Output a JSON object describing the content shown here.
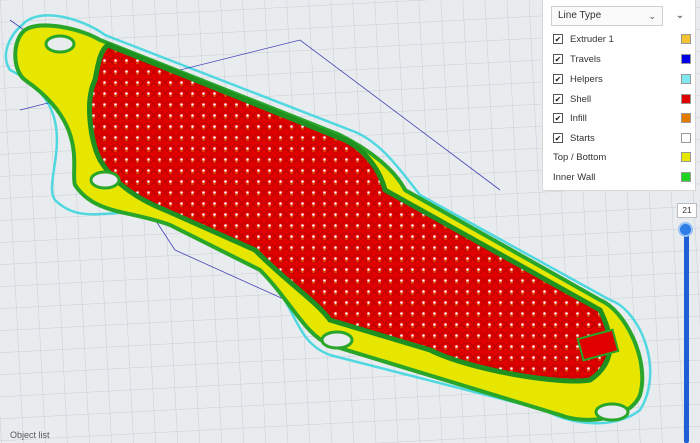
{
  "legend": {
    "dropdown": {
      "selected": "Line Type"
    },
    "items": [
      {
        "label": "Extruder 1",
        "checked": true,
        "color": "#f2c230"
      },
      {
        "label": "Travels",
        "checked": true,
        "color": "#0000e6"
      },
      {
        "label": "Helpers",
        "checked": true,
        "color": "#7fe8ee"
      },
      {
        "label": "Shell",
        "checked": true,
        "color": "#e00000"
      },
      {
        "label": "Infill",
        "checked": true,
        "color": "#e67a00"
      },
      {
        "label": "Starts",
        "checked": true,
        "color": "#ffffff"
      },
      {
        "label": "Top / Bottom",
        "checked": null,
        "color": "#e6e600"
      },
      {
        "label": "Inner Wall",
        "checked": null,
        "color": "#1fd41f"
      }
    ]
  },
  "layer_slider": {
    "value": "21",
    "level": 1.0
  },
  "footer": {
    "object_list_label": "Object list"
  },
  "colors": {
    "grid_bg": "#e9ecef",
    "grid_line": "#c9ced3",
    "helpers": "#4fd8e0",
    "top_bottom": "#e6e600",
    "inner_wall": "#29a629",
    "shell": "#e00000",
    "infill": "#e67a00",
    "travels": "#1a1aa8"
  }
}
